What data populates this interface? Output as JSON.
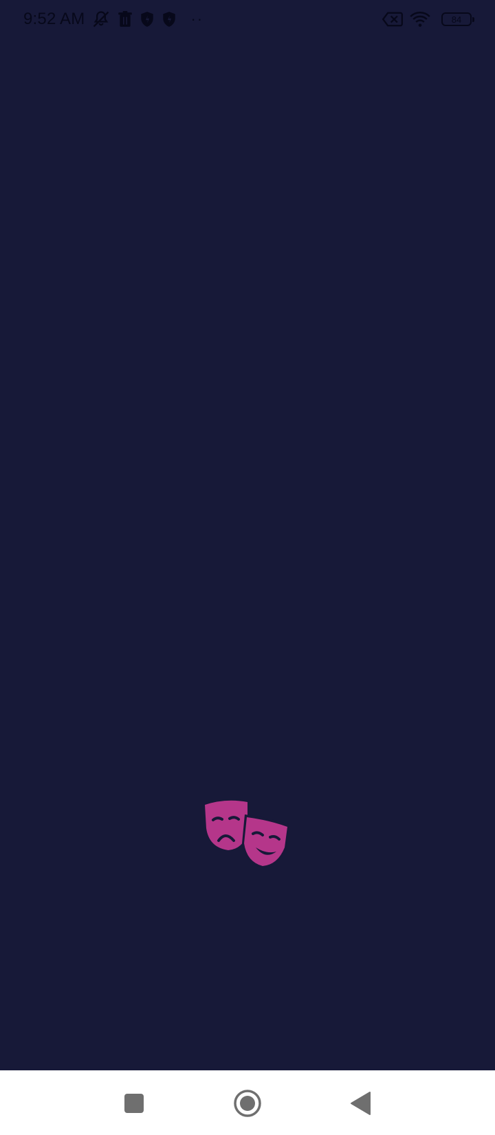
{
  "status_bar": {
    "time": "9:52 AM",
    "battery_level": "84",
    "icons": [
      "mute-icon",
      "trash-icon",
      "shield-icon",
      "shield-icon",
      "more-dots",
      "sim-off-icon",
      "wifi-icon",
      "battery-icon"
    ],
    "dots": "··"
  },
  "splash": {
    "logo_icon": "theater-masks-icon",
    "logo_color": "#b5368a",
    "background_color": "#171938"
  },
  "nav_bar": {
    "buttons": [
      "recents-button",
      "home-button",
      "back-button"
    ],
    "icon_color": "#6f6f6f"
  }
}
